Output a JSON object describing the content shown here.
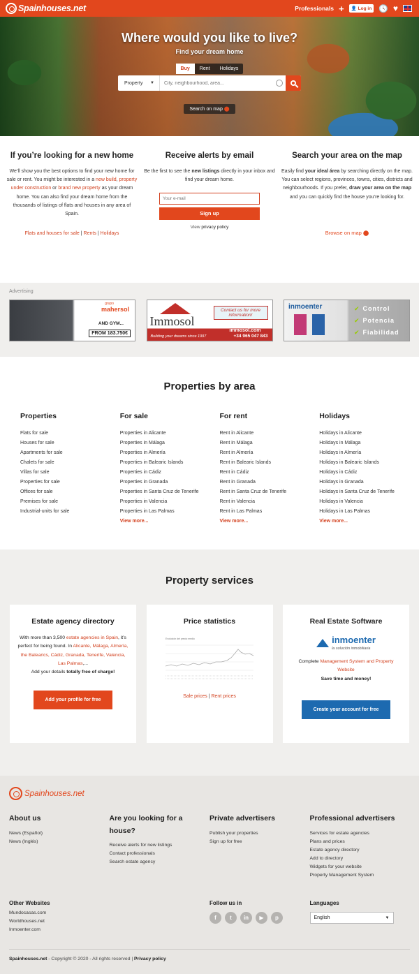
{
  "header": {
    "logo": "Spainhouses.net",
    "professionals": "Professionals",
    "login": "Log in"
  },
  "hero": {
    "title": "Where would you like to live?",
    "subtitle": "Find your dream home",
    "tabs": [
      "Buy",
      "Rent",
      "Holidays"
    ],
    "select_value": "Property",
    "search_placeholder": "City, neighbourhood, area...",
    "map_link": "Search on map"
  },
  "features": {
    "f1": {
      "title": "If you’re looking for a new home",
      "p1": "We’ll show you the best options to find your new home for sale or rent. You might be interested in a ",
      "l1": "new build",
      "sep1": ", ",
      "l2": "property under construction",
      "sep2": " or ",
      "l3": "brand new property",
      "p2": " as your dream home. You can also find your dream home from the thousands of listings of flats and houses in any area of Spain.",
      "links": [
        "Flats and houses for sale",
        "Rents",
        "Holidays"
      ],
      "divider": " | "
    },
    "f2": {
      "title": "Receive alerts by email",
      "p1": "Be the first to see the ",
      "b1": "new listings",
      "p2": " directly in your inbox and find your dream home.",
      "email_placeholder": "Your e-mail",
      "signup": "Sign up",
      "privacy_pre": "View ",
      "privacy": "privacy policy"
    },
    "f3": {
      "title": "Search your area on the map",
      "p1": "Easily find ",
      "b1": "your ideal área",
      "p2": " by searching directly on the map. You can select regions, provinces, towns, cities, districts and neighbourhoods. If you prefer, ",
      "b2": "draw your area on the map",
      "p3": " and you can quickly find the house you’re looking for.",
      "browse": "Browse on map"
    }
  },
  "ads": {
    "label": "Advertising",
    "ad1": {
      "brand": "mahersol",
      "tag": "grupo",
      "t1": "AND GYM...",
      "t2": "FROM 183.750€"
    },
    "ad2": {
      "brand": "Immosol",
      "bubble": "Contact us for more information!",
      "s1": "Building your dreams since 1997",
      "s2": "+34 965 047 843",
      "s3": "immosol.com"
    },
    "ad3": {
      "brand": "inmoenter",
      "items": [
        "Control",
        "Potencia",
        "Fiabilidad"
      ]
    }
  },
  "byarea": {
    "title": "Properties by area",
    "cols": [
      {
        "h": "Properties",
        "items": [
          "Flats for sale",
          "Houses for sale",
          "Apartments for sale",
          "Chalets for sale",
          "Villas for sale",
          "Properties for sale",
          "Offices for sale",
          "Premises for sale",
          "Industrial-units for sale"
        ]
      },
      {
        "h": "For sale",
        "items": [
          "Properties in Alicante",
          "Properties in Málaga",
          "Properties in Almería",
          "Properties in Balearic Islands",
          "Properties in Cádiz",
          "Properties in Granada",
          "Properties in Santa Cruz de Tenerife",
          "Properties in Valencia",
          "Properties in Las Palmas"
        ],
        "more": "View more..."
      },
      {
        "h": "For rent",
        "items": [
          "Rent in Alicante",
          "Rent in Málaga",
          "Rent in Almería",
          "Rent in Balearic Islands",
          "Rent in Cádiz",
          "Rent in Granada",
          "Rent in Santa Cruz de Tenerife",
          "Rent in Valencia",
          "Rent in Las Palmas"
        ],
        "more": "View more..."
      },
      {
        "h": "Holidays",
        "items": [
          "Holidays in Alicante",
          "Holidays in Málaga",
          "Holidays in Almería",
          "Holidays in Balearic Islands",
          "Holidays in Cádiz",
          "Holidays in Granada",
          "Holidays in Santa Cruz de Tenerife",
          "Holidays in Valencia",
          "Holidays in Las Palmas"
        ],
        "more": "View more..."
      }
    ]
  },
  "services": {
    "title": "Property services",
    "c1": {
      "h": "Estate agency directory",
      "p1": "With more than 3,500 ",
      "l1": "estate agencies in Spain",
      "p2": ", it’s perfect for being found. In ",
      "l2": "Alicante, Málaga, Almería, the Balearics, Cádiz, Granada, Tenerife, Valencia, Las Palmas",
      "p3": ",...",
      "p4": "Add your details ",
      "b1": "totally free of charge!",
      "btn": "Add your profile for free"
    },
    "c2": {
      "h": "Price statistics",
      "links": [
        "Sale prices",
        "Rent prices"
      ],
      "divider": " | ",
      "chart_caption": "Evolución del precio medio"
    },
    "c3": {
      "h": "Real Estate Software",
      "logo": "inmoenter",
      "logo_tag": "la solución inmobiliaria",
      "p1": "Complete ",
      "l1": "Management System and Property Website",
      "b1": "Save time and money!",
      "btn": "Create your account for free"
    }
  },
  "footer": {
    "logo": "Spainhouses.net",
    "cols": [
      {
        "h": "About us",
        "items": [
          "News (Español)",
          "News (Inglés)"
        ]
      },
      {
        "h": "Are you looking for a house?",
        "items": [
          "Receive alerts for new listings",
          "Contact professionals",
          "Search estate agency"
        ]
      },
      {
        "h": "Private advertisers",
        "items": [
          "Publish your properties",
          "Sign up for free"
        ]
      },
      {
        "h": "Professional advertisers",
        "items": [
          "Services for estate agencies",
          "Plans and prices",
          "Estate agency directory",
          "Add to directory",
          "Widgets for your website",
          "Property Management System"
        ]
      }
    ],
    "other": {
      "h": "Other Websites",
      "items": [
        "Mundocasas.com",
        "Worldhouses.net",
        "Inmoenter.com"
      ]
    },
    "follow": {
      "h": "Follow us in",
      "icons": [
        "f",
        "t",
        "in",
        "▶",
        "p"
      ]
    },
    "lang": {
      "h": "Languages",
      "value": "English"
    },
    "copy": {
      "site": "Spainhouses.net",
      "text": " - Copyright © 2020 - All rights reserved | ",
      "privacy": "Privacy policy"
    }
  },
  "colors": {
    "brand": "#e2471d",
    "blue": "#1d6ab0"
  }
}
